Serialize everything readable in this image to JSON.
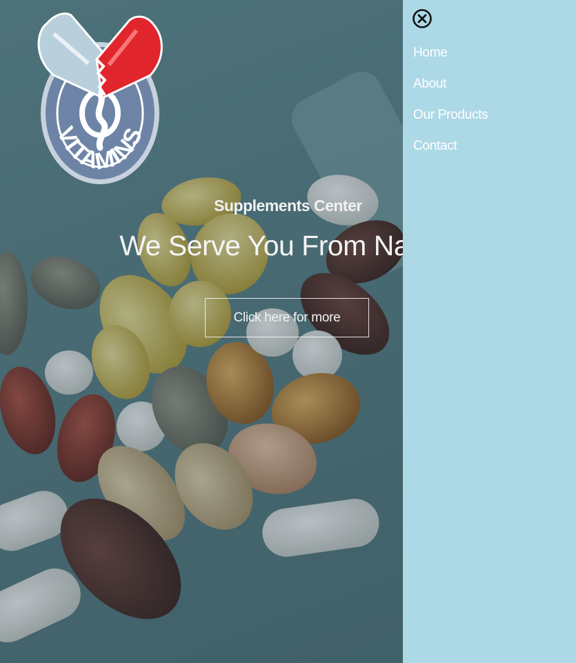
{
  "logo": {
    "text": "VITAMINS",
    "icon": "vitamin-capsule-heart-logo"
  },
  "hero": {
    "subtitle": "Supplements Center",
    "headline": "We Serve You From Nature",
    "cta_label": "Click here for more"
  },
  "menu": {
    "close_icon": "close-circle-icon",
    "items": [
      {
        "label": "Home"
      },
      {
        "label": "About"
      },
      {
        "label": "Our Products"
      },
      {
        "label": "Contact"
      }
    ]
  },
  "colors": {
    "menu_background": "#add8e6",
    "menu_text": "#ffffff",
    "logo_blue": "#6d84a6",
    "logo_red": "#e0262c"
  }
}
